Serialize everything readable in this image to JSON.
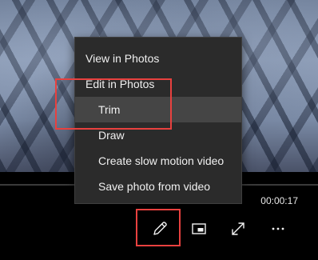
{
  "player": {
    "time": "00:00:17",
    "controls": {
      "edit_icon": "pencil-icon",
      "mini_icon": "mini-view-icon",
      "fullscreen_icon": "expand-icon",
      "more_icon": "more-icon"
    }
  },
  "menu": {
    "items": [
      {
        "label": "View in Photos"
      },
      {
        "label": "Edit in Photos"
      },
      {
        "label": "Trim"
      },
      {
        "label": "Draw"
      },
      {
        "label": "Create slow motion video"
      },
      {
        "label": "Save photo from video"
      }
    ]
  },
  "colors": {
    "highlight_box": "#e8413f",
    "menu_background": "#2b2b2b",
    "menu_selected": "#454545"
  }
}
